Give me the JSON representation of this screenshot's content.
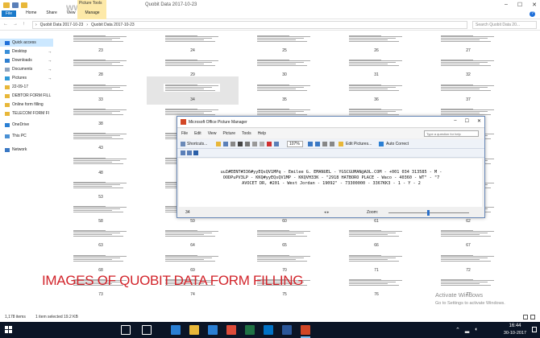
{
  "explorer": {
    "overlay_logo_text": "www.b",
    "contextual_tab": "Picture Tools",
    "window_title": "Quobit Data 2017-10-23",
    "ribbon_tabs": [
      "File",
      "Home",
      "Share",
      "View",
      "Manage"
    ],
    "breadcrumb": [
      "Quobit Data 2017-10-23",
      "Quobit Data 2017-10-23"
    ],
    "search_placeholder": "Search Quobit Data 20...",
    "status_items": "1,178 items",
    "status_selected": "1 item selected  19.2 KB"
  },
  "nav_pane": {
    "items": [
      {
        "label": "Quick access",
        "icon": "star-icon",
        "color": "#1e6fd9",
        "pinned": false
      },
      {
        "label": "Desktop",
        "icon": "desktop-icon",
        "color": "#3a8fd8",
        "pinned": true
      },
      {
        "label": "Downloads",
        "icon": "download-icon",
        "color": "#2f7fd0",
        "pinned": true
      },
      {
        "label": "Documents",
        "icon": "documents-icon",
        "color": "#8ea4bf",
        "pinned": true
      },
      {
        "label": "Pictures",
        "icon": "pictures-icon",
        "color": "#2f9ad8",
        "pinned": true
      },
      {
        "label": "22-09-17",
        "icon": "folder-icon",
        "color": "#e8b739",
        "pinned": false
      },
      {
        "label": "DEBTOR FORM FILL",
        "icon": "folder-icon",
        "color": "#e8b739",
        "pinned": false
      },
      {
        "label": "Online form filling",
        "icon": "folder-icon",
        "color": "#e8b739",
        "pinned": false
      },
      {
        "label": "TELECOM FORM FI",
        "icon": "folder-icon",
        "color": "#e8b739",
        "pinned": false
      },
      {
        "label": "OneDrive",
        "icon": "cloud-icon",
        "color": "#2a7fd4",
        "pinned": false
      },
      {
        "label": "This PC",
        "icon": "computer-icon",
        "color": "#4a90d4",
        "pinned": false
      },
      {
        "label": "Network",
        "icon": "network-icon",
        "color": "#3a78c4",
        "pinned": false
      }
    ]
  },
  "grid": {
    "rows": [
      [
        "23",
        "24",
        "25",
        "26",
        "27"
      ],
      [
        "28",
        "29",
        "30",
        "31",
        "32"
      ],
      [
        "33",
        "34",
        "35",
        "36",
        "37"
      ],
      [
        "38",
        "39",
        "40",
        "41",
        "42"
      ],
      [
        "43",
        "44",
        "45",
        "46",
        "47"
      ],
      [
        "48",
        "49",
        "50",
        "51",
        "52"
      ],
      [
        "53",
        "54",
        "55",
        "56",
        "57"
      ],
      [
        "58",
        "59",
        "60",
        "61",
        "62"
      ],
      [
        "63",
        "64",
        "65",
        "66",
        "67"
      ],
      [
        "68",
        "69",
        "70",
        "71",
        "72"
      ],
      [
        "73",
        "74",
        "75",
        "76",
        "77"
      ]
    ],
    "highlighted": "34"
  },
  "picture_manager": {
    "title": "Microsoft Office Picture Manager",
    "menus": [
      "File",
      "Edit",
      "View",
      "Picture",
      "Tools",
      "Help"
    ],
    "help_placeholder": "Type a question for help",
    "shortcuts_label": "Shortcuts...",
    "zoom_value": "107%",
    "edit_pictures_label": "Edit Pictures...",
    "auto_correct_label": "Auto Correct",
    "ocr_lines": [
      "uuI#EENT#336#yyEQsQV1MPq -  Emilee G. EMANUEL - YGSCGUMAN@AOL.COM - +001 034 313585 - M -",
      "OODPuPV3LP - KKQ#yyEQsQV1MP - KKQVH33K - \"2918 HATBORO PLACE - Waco - 40360 - WT\" - \"7",
      "AVOCET DR, #201 - West Jordan - 19092\" - 73300000 - 3367KK3 - 1 - Y - 2"
    ],
    "picture_number": "34",
    "zoom_label": "Zoom:"
  },
  "overlay": {
    "caption": "IMAGES OF QUOBIT DATA FORM FILLING",
    "activate_title": "Activate Windows",
    "activate_sub": "Go to Settings to activate Windows."
  },
  "taskbar": {
    "apps": [
      {
        "icon": "cortana-icon",
        "color": "#ffffff"
      },
      {
        "icon": "task-view-icon",
        "color": "#ffffff"
      },
      {
        "icon": "edge-icon",
        "color": "#2a7fd4"
      },
      {
        "icon": "file-explorer-icon",
        "color": "#e8b739"
      },
      {
        "icon": "store-icon",
        "color": "#2a7fd4"
      },
      {
        "icon": "chrome-icon",
        "color": "#dd4b39"
      },
      {
        "icon": "excel-icon",
        "color": "#1f7244"
      },
      {
        "icon": "outlook-icon",
        "color": "#0072c6"
      },
      {
        "icon": "word-icon",
        "color": "#2b579a"
      },
      {
        "icon": "picture-manager-icon",
        "color": "#d24726"
      }
    ],
    "time": "16:44",
    "date": "30-10-2017"
  }
}
